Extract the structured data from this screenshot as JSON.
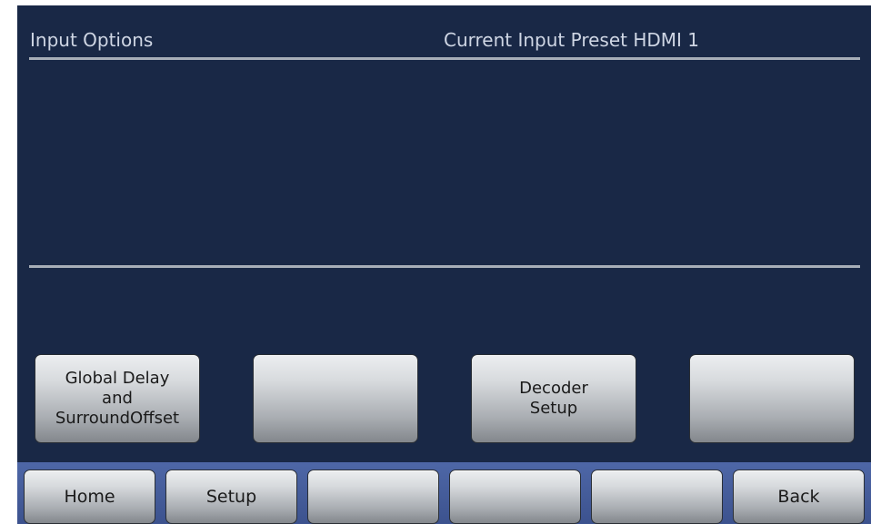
{
  "header": {
    "title": "Input Options",
    "current_preset": "Current Input Preset HDMI 1"
  },
  "function_buttons": [
    {
      "label": "Global Delay\nand\nSurroundOffset"
    },
    {
      "label": ""
    },
    {
      "label": "Decoder\nSetup"
    },
    {
      "label": ""
    }
  ],
  "nav_buttons": [
    {
      "label": "Home"
    },
    {
      "label": "Setup"
    },
    {
      "label": ""
    },
    {
      "label": ""
    },
    {
      "label": ""
    },
    {
      "label": "Back"
    }
  ],
  "colors": {
    "screen_background": "#192846",
    "nav_bar": "#4e67a7",
    "text": "#cfd6e4"
  }
}
